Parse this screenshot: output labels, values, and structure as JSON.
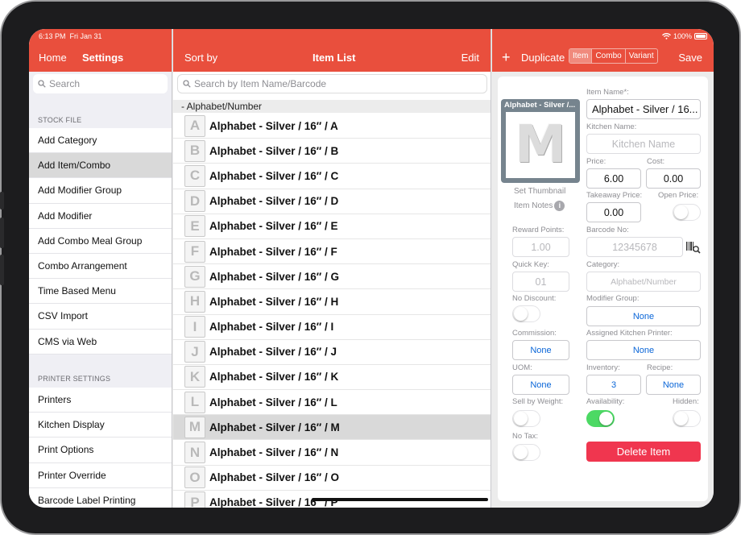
{
  "status": {
    "time": "6:13 PM",
    "date": "Fri Jan 31",
    "battery": "100%"
  },
  "left": {
    "nav_home": "Home",
    "nav_title": "Settings",
    "search_placeholder": "Search",
    "section_stock": "STOCK FILE",
    "stock_items": [
      "Add Category",
      "Add Item/Combo",
      "Add Modifier Group",
      "Add Modifier",
      "Add Combo Meal Group",
      "Combo Arrangement",
      "Time Based Menu",
      "CSV Import",
      "CMS via Web"
    ],
    "selected_index": 1,
    "section_printer": "PRINTER SETTINGS",
    "printer_items": [
      "Printers",
      "Kitchen Display",
      "Print Options",
      "Printer Override",
      "Barcode Label Printing"
    ]
  },
  "middle": {
    "nav_sort": "Sort by",
    "nav_title": "Item List",
    "nav_edit": "Edit",
    "search_placeholder": "Search by Item Name/Barcode",
    "group_header": "- Alphabet/Number",
    "items": [
      {
        "letter": "A",
        "name": "Alphabet - Silver / 16″ / A"
      },
      {
        "letter": "B",
        "name": "Alphabet - Silver / 16″ / B"
      },
      {
        "letter": "C",
        "name": "Alphabet - Silver / 16″ / C"
      },
      {
        "letter": "D",
        "name": "Alphabet - Silver / 16″ / D"
      },
      {
        "letter": "E",
        "name": "Alphabet - Silver / 16″ / E"
      },
      {
        "letter": "F",
        "name": "Alphabet - Silver / 16″ / F"
      },
      {
        "letter": "G",
        "name": "Alphabet - Silver / 16″ / G"
      },
      {
        "letter": "H",
        "name": "Alphabet - Silver / 16″ / H"
      },
      {
        "letter": "I",
        "name": "Alphabet - Silver / 16″ / I"
      },
      {
        "letter": "J",
        "name": "Alphabet - Silver / 16″ / J"
      },
      {
        "letter": "K",
        "name": "Alphabet - Silver / 16″ / K"
      },
      {
        "letter": "L",
        "name": "Alphabet - Silver / 16″ / L"
      },
      {
        "letter": "M",
        "name": "Alphabet - Silver / 16″ / M"
      },
      {
        "letter": "N",
        "name": "Alphabet - Silver / 16″ / N"
      },
      {
        "letter": "O",
        "name": "Alphabet - Silver / 16″ / O"
      },
      {
        "letter": "P",
        "name": "Alphabet - Silver / 16″ / P"
      }
    ],
    "selected_index": 12
  },
  "right": {
    "duplicate_label": "Duplicate",
    "seg_item": "Item",
    "seg_combo": "Combo",
    "seg_variant": "Variant",
    "save_label": "Save",
    "thumb_title": "Alphabet - Silver /...",
    "thumb_letter": "M",
    "set_thumbnail": "Set Thumbnail",
    "item_notes": "Item Notes",
    "item_name_label": "Item Name*:",
    "item_name_value": "Alphabet - Silver / 16...",
    "kitchen_name_label": "Kitchen Name:",
    "kitchen_name_placeholder": "Kitchen Name",
    "price_label": "Price:",
    "price_value": "6.00",
    "cost_label": "Cost:",
    "cost_value": "0.00",
    "takeaway_label": "Takeaway Price:",
    "takeaway_value": "0.00",
    "open_price_label": "Open Price:",
    "reward_label": "Reward Points:",
    "reward_value": "1.00",
    "barcode_label": "Barcode No:",
    "barcode_placeholder": "12345678",
    "quick_key_label": "Quick Key:",
    "quick_key_value": "01",
    "category_label": "Category:",
    "category_value": "Alphabet/Number",
    "no_discount_label": "No Discount:",
    "modifier_group_label": "Modifier Group:",
    "modifier_group_value": "None",
    "commission_label": "Commission:",
    "commission_value": "None",
    "kitchen_printer_label": "Assigned Kitchen Printer:",
    "kitchen_printer_value": "None",
    "uom_label": "UOM:",
    "uom_value": "None",
    "inventory_label": "Inventory:",
    "inventory_value": "3",
    "recipe_label": "Recipe:",
    "recipe_value": "None",
    "sell_weight_label": "Sell by Weight:",
    "availability_label": "Availability:",
    "hidden_label": "Hidden:",
    "no_tax_label": "No Tax:",
    "delete_label": "Delete Item",
    "toggles": {
      "open_price": false,
      "no_discount": false,
      "sell_by_weight": false,
      "availability": true,
      "hidden": false,
      "no_tax": false
    }
  },
  "colors": {
    "brand": "#e94f3d",
    "delete": "#f0364f",
    "toggle_on": "#4cd964",
    "link": "#0a66d8"
  }
}
